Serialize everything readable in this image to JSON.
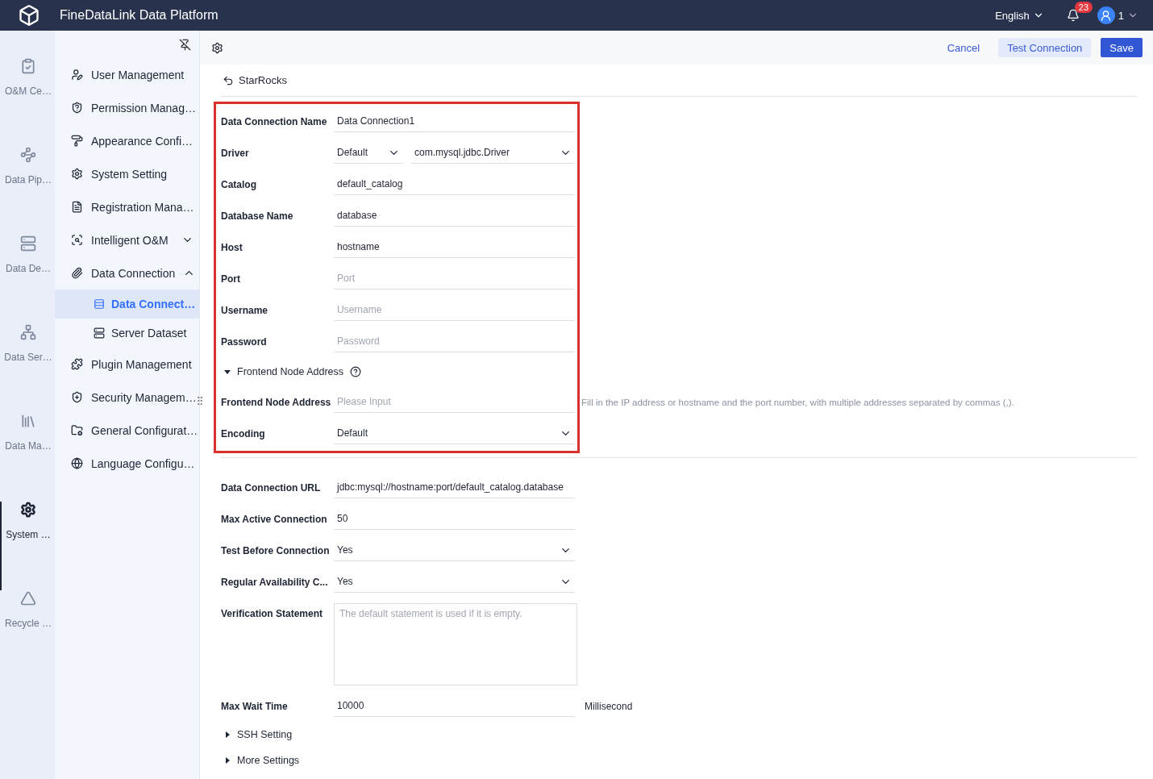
{
  "app": {
    "title": "FineDataLink Data Platform",
    "language": "English",
    "notification_count": "23",
    "user": "1"
  },
  "rail": [
    {
      "label": "O&M Ce…",
      "selected": false
    },
    {
      "label": "Data Pip…",
      "selected": false
    },
    {
      "label": "Data De…",
      "selected": false
    },
    {
      "label": "Data Ser…",
      "selected": false
    },
    {
      "label": "Data Ma…",
      "selected": false
    },
    {
      "label": "System …",
      "selected": true
    },
    {
      "label": "Recycle …",
      "selected": false
    }
  ],
  "sidebar": {
    "items": [
      {
        "kind": "link",
        "label": "User Management",
        "selected": false
      },
      {
        "kind": "link",
        "label": "Permission Manag…",
        "selected": false
      },
      {
        "kind": "link",
        "label": "Appearance Confi…",
        "selected": false
      },
      {
        "kind": "link",
        "label": "System Setting",
        "selected": false
      },
      {
        "kind": "link",
        "label": "Registration Mana…",
        "selected": false
      },
      {
        "kind": "group",
        "label": "Intelligent O&M",
        "selected": false,
        "expanded": false
      },
      {
        "kind": "group",
        "label": "Data Connection",
        "selected": false,
        "expanded": true,
        "children": [
          {
            "label": "Data Connect…",
            "selected": true
          },
          {
            "label": "Server Dataset",
            "selected": false
          }
        ]
      },
      {
        "kind": "link",
        "label": "Plugin Management",
        "selected": false
      },
      {
        "kind": "link",
        "label": "Security Managem…",
        "selected": false
      },
      {
        "kind": "link",
        "label": "General Configurat…",
        "selected": false
      },
      {
        "kind": "link",
        "label": "Language Configu…",
        "selected": false
      }
    ]
  },
  "toolbar": {
    "buttons": [
      {
        "kind": "link",
        "label": "Cancel"
      },
      {
        "kind": "secondary",
        "label": "Test Connection"
      },
      {
        "kind": "primary",
        "label": "Save"
      }
    ]
  },
  "breadcrumb": "StarRocks",
  "form": {
    "highlighted_rows": [
      {
        "kind": "input",
        "label": "Data Connection Name",
        "value": "Data Connection1"
      },
      {
        "kind": "double_select",
        "label": "Driver",
        "values": [
          "Default",
          "com.mysql.jdbc.Driver"
        ]
      },
      {
        "kind": "input",
        "label": "Catalog",
        "value": "default_catalog"
      },
      {
        "kind": "input",
        "label": "Database Name",
        "value": "database"
      },
      {
        "kind": "input",
        "label": "Host",
        "value": "hostname"
      },
      {
        "kind": "input",
        "label": "Port",
        "placeholder": "Port"
      },
      {
        "kind": "input",
        "label": "Username",
        "placeholder": "Username"
      },
      {
        "kind": "input",
        "label": "Password",
        "placeholder": "Password"
      },
      {
        "kind": "section",
        "label": "Frontend Node Address",
        "expanded": true
      },
      {
        "kind": "input",
        "label": "Frontend Node Address",
        "placeholder": "Please Input",
        "hint": "Fill in the IP address or hostname and the port number, with multiple addresses separated by commas (,)."
      },
      {
        "kind": "select",
        "label": "Encoding",
        "value": "Default"
      }
    ],
    "rows": [
      {
        "kind": "input",
        "label": "Data Connection URL",
        "value": "jdbc:mysql://hostname:port/default_catalog.database"
      },
      {
        "kind": "input",
        "label": "Max Active Connection",
        "value": "50"
      },
      {
        "kind": "select",
        "label": "Test Before Connection",
        "value": "Yes"
      },
      {
        "kind": "select",
        "label": "Regular Availability C...",
        "value": "Yes"
      },
      {
        "kind": "textarea",
        "label": "Verification Statement",
        "placeholder": "The default statement is used if it is empty."
      },
      {
        "kind": "input",
        "label": "Max Wait Time",
        "value": "10000",
        "suffix": "Millisecond"
      },
      {
        "kind": "section",
        "label": "SSH Setting",
        "expanded": false
      },
      {
        "kind": "section",
        "label": "More Settings",
        "expanded": false
      }
    ]
  }
}
